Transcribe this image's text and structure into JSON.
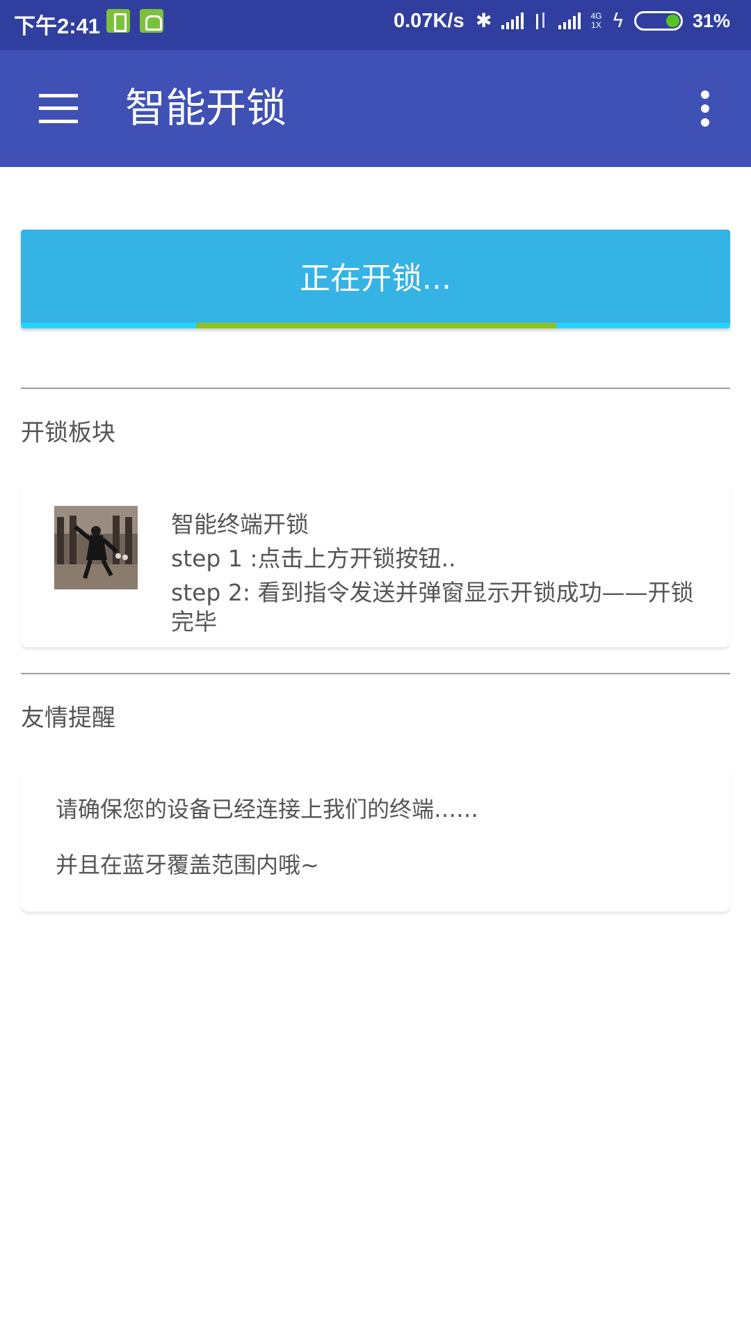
{
  "status_bar": {
    "time": "下午2:41",
    "net_speed": "0.07K/s",
    "network_type_top": "4G",
    "network_type_bottom": "1X",
    "battery_percent": "31%",
    "battery_level": 0.31,
    "bluetooth_icon": "bluetooth-icon",
    "charging_icon": "bolt-icon"
  },
  "app_bar": {
    "title": "智能开锁",
    "menu_icon": "hamburger-menu-icon",
    "overflow_icon": "more-vert-icon",
    "color": "#3f51b5"
  },
  "unlock_button": {
    "label": "正在开锁...",
    "color": "#35b3e4",
    "progress_color": "#8cc31e",
    "progress_track_color": "#23d6ff"
  },
  "unlock_section": {
    "heading": "开锁板块",
    "item_title": "智能终端开锁",
    "step1": "step 1 :点击上方开锁按钮..",
    "step2_line1": "step 2: 看到指令发送并弹窗显示开锁成功——开锁",
    "step2_line2": "完毕"
  },
  "reminder_section": {
    "heading": "友情提醒",
    "line1": "请确保您的设备已经连接上我们的终端……",
    "line2": "并且在蓝牙覆盖范围内哦~"
  }
}
